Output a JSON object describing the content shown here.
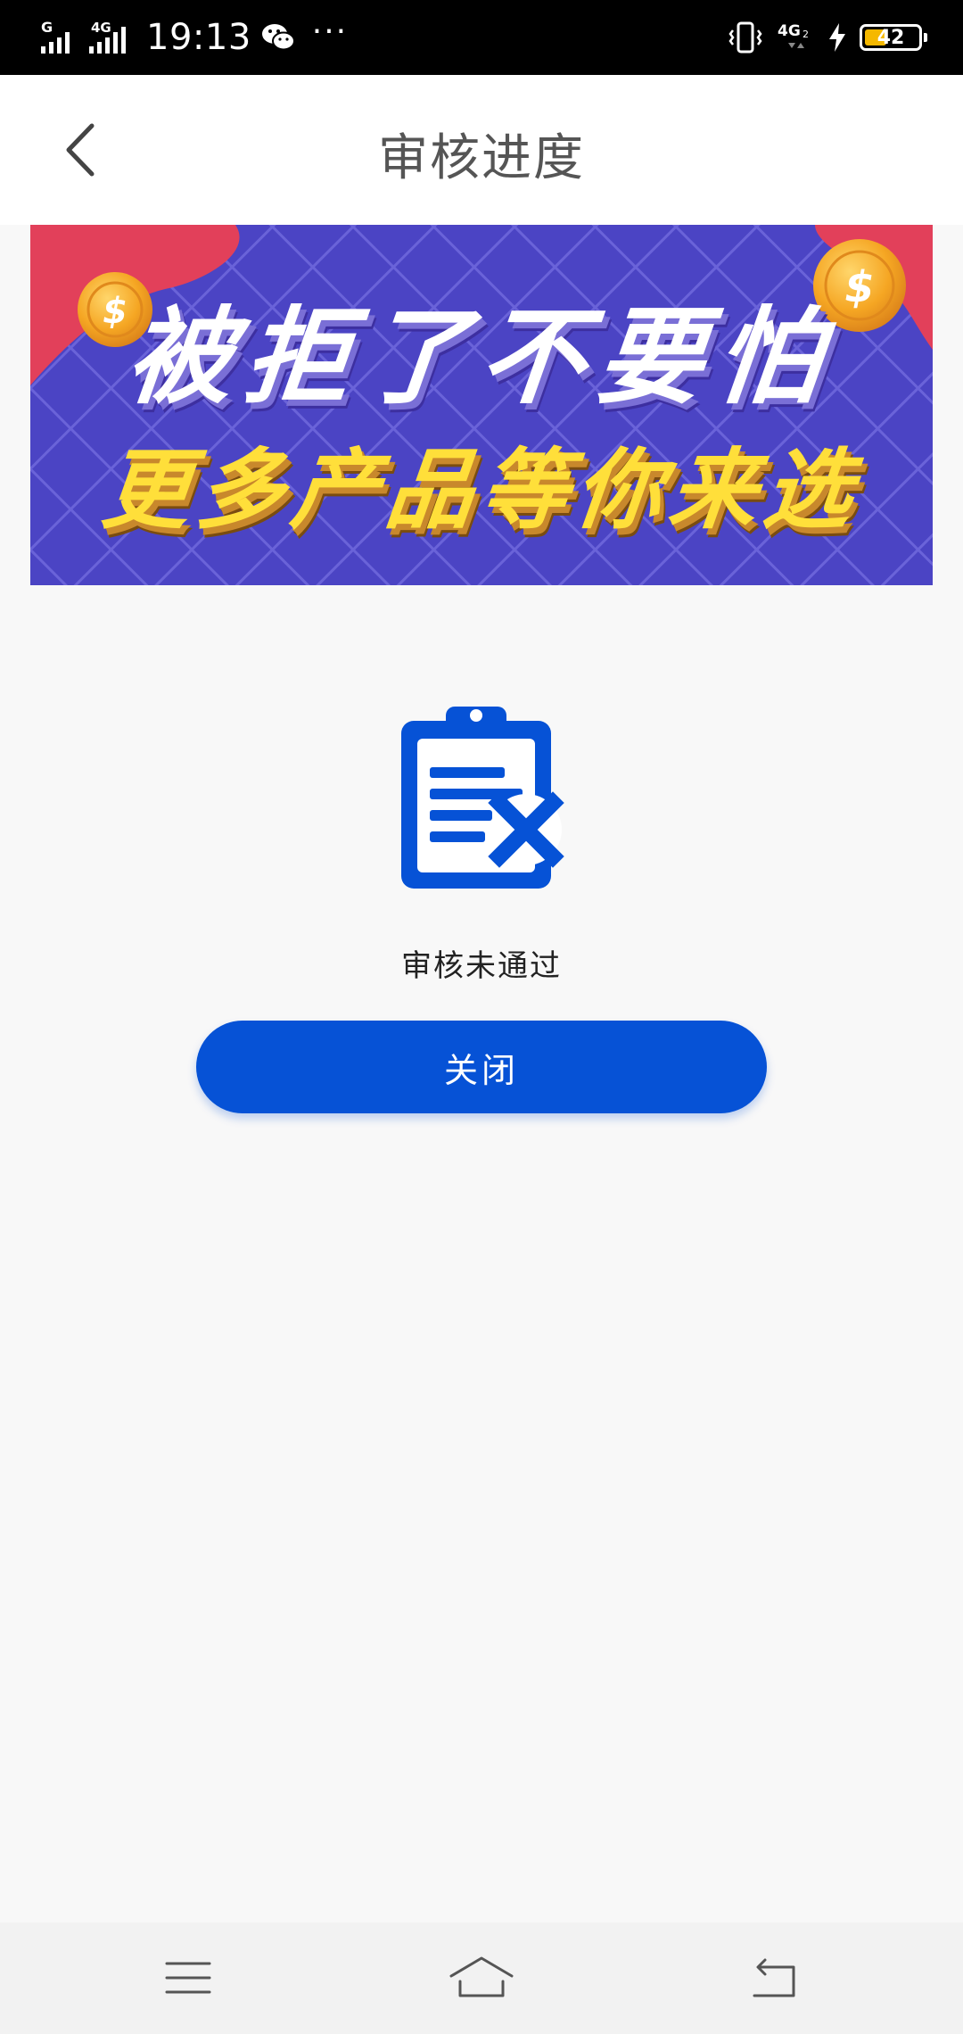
{
  "status_bar": {
    "sim1_label": "G",
    "sim2_label": "4G",
    "time": "19:13",
    "more": "···",
    "right_network": "4G",
    "right_network_sub": "2",
    "battery_level": "42",
    "battery_fraction": 0.42
  },
  "header": {
    "title": "审核进度"
  },
  "banner": {
    "line1": "被拒了不要怕",
    "line2": "更多产品等你来选",
    "coin_symbol": "$"
  },
  "result": {
    "status_text": "审核未通过",
    "close_label": "关闭"
  },
  "colors": {
    "primary": "#0652d6",
    "banner_bg": "#4b44c4",
    "banner_accent": "#e2405a",
    "coin": "#f5a623"
  }
}
